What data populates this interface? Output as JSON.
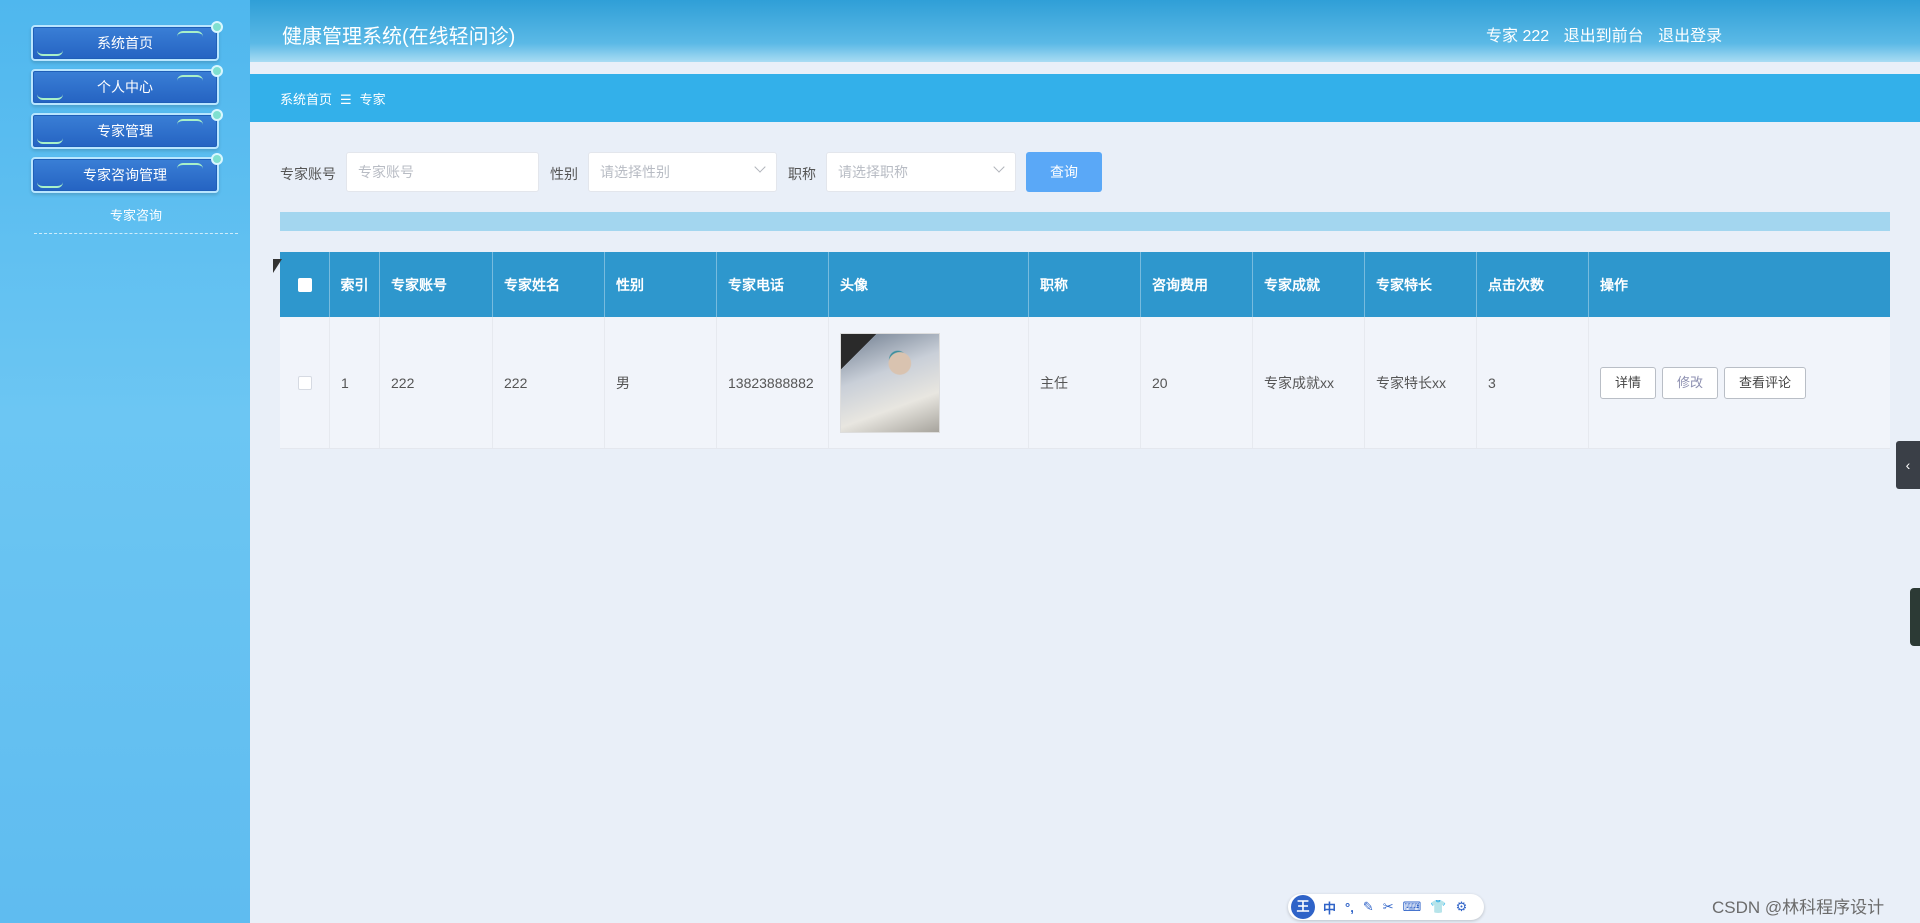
{
  "sidebar": {
    "items": [
      {
        "label": "系统首页"
      },
      {
        "label": "个人中心"
      },
      {
        "label": "专家管理"
      },
      {
        "label": "专家咨询管理"
      }
    ],
    "sub_item": "专家咨询"
  },
  "header": {
    "title": "健康管理系统(在线轻问诊)",
    "user": "专家 222",
    "front_link": "退出到前台",
    "logout_link": "退出登录"
  },
  "breadcrumb": {
    "home": "系统首页",
    "separator": "☰",
    "current": "专家"
  },
  "search": {
    "account_label": "专家账号",
    "account_placeholder": "专家账号",
    "gender_label": "性别",
    "gender_placeholder": "请选择性别",
    "title_label": "职称",
    "title_placeholder": "请选择职称",
    "query_button": "查询"
  },
  "table": {
    "columns": [
      "索引",
      "专家账号",
      "专家姓名",
      "性别",
      "专家电话",
      "头像",
      "职称",
      "咨询费用",
      "专家成就",
      "专家特长",
      "点击次数",
      "操作"
    ],
    "rows": [
      {
        "index": "1",
        "account": "222",
        "name": "222",
        "gender": "男",
        "phone": "13823888882",
        "title": "主任",
        "fee": "20",
        "achievement": "专家成就xx",
        "specialty": "专家特长xx",
        "clicks": "3",
        "actions": {
          "detail": "详情",
          "edit": "修改",
          "reviews": "查看评论"
        }
      }
    ]
  },
  "ime": {
    "logo": "王",
    "icons": [
      "中",
      "°,",
      "pen-icon",
      "scissors-icon",
      "keyboard-icon",
      "shirt-icon",
      "gear-icon"
    ],
    "icon_glyphs": [
      "中",
      "°,",
      "✎",
      "✂",
      "⌨",
      "👕",
      "⚙"
    ]
  },
  "watermark": "CSDN @林科程序设计",
  "colors": {
    "sidebar": "#5fbcf0",
    "header": "#2f9fd7",
    "breadcrumb": "#33b0ea",
    "table_header": "#2e97cd",
    "query_button": "#5aa8f7"
  }
}
